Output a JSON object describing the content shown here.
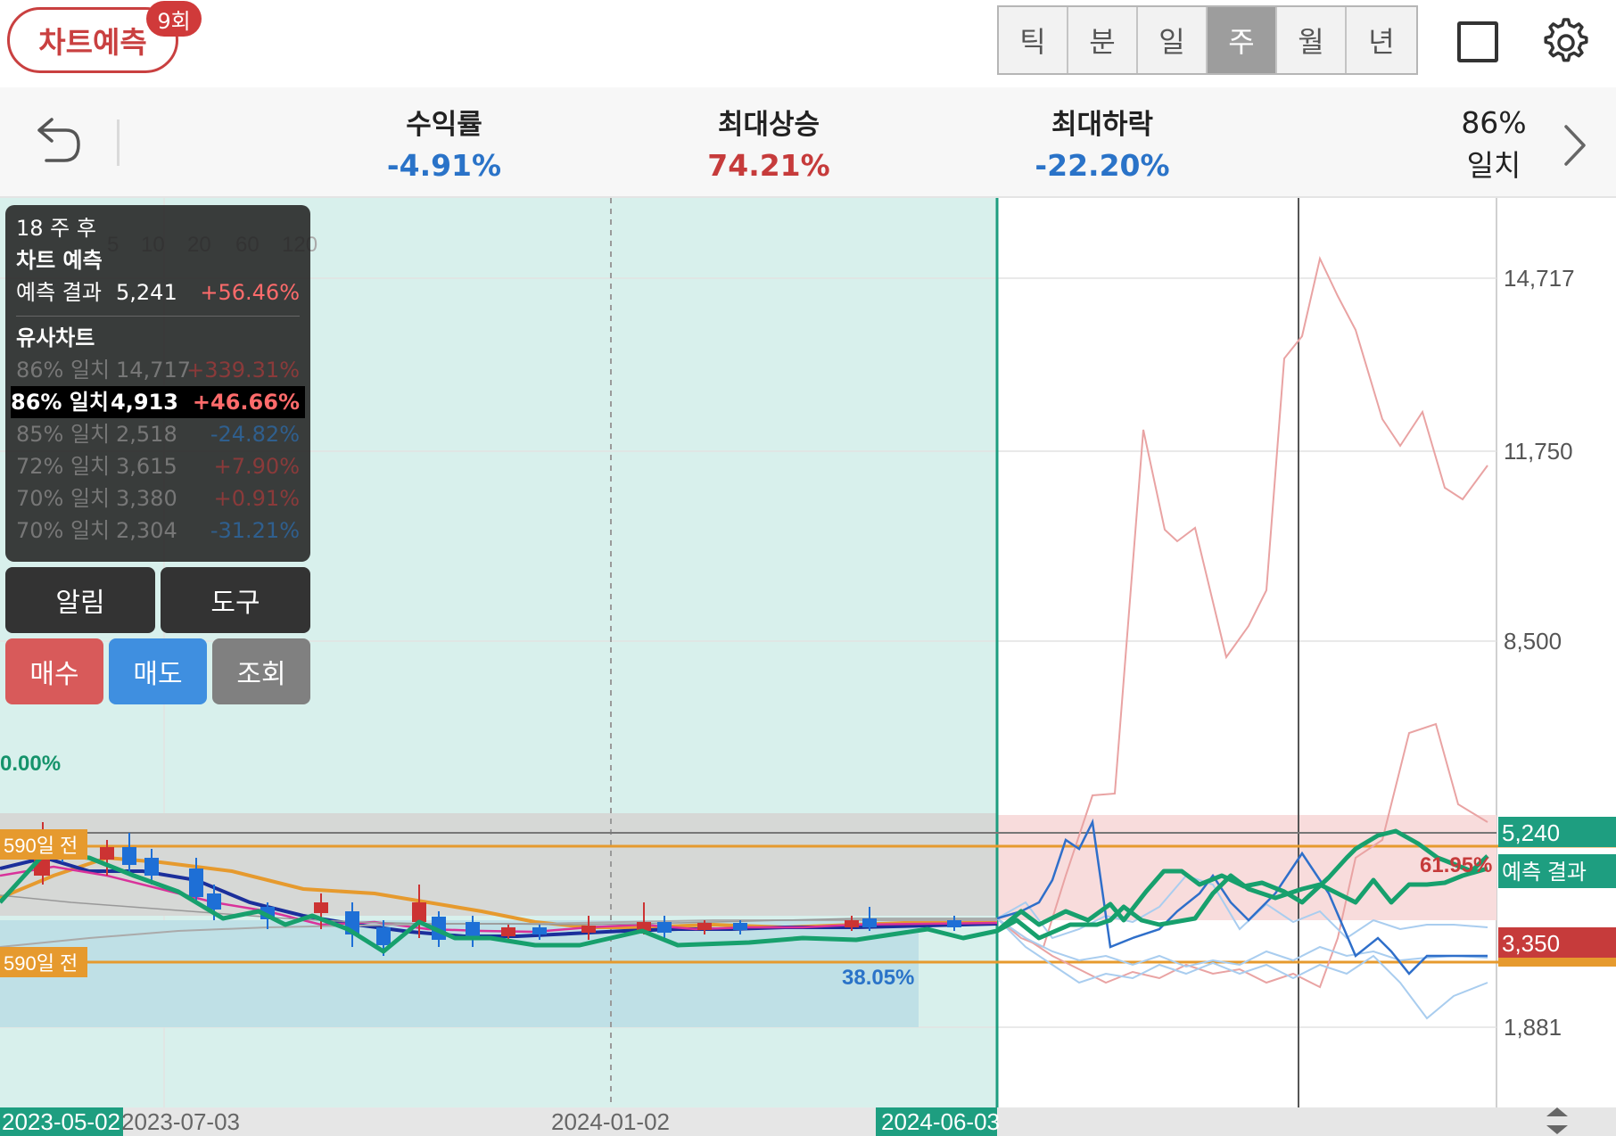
{
  "topbar": {
    "predict_label": "차트예측",
    "predict_badge": "9회",
    "period_tabs": [
      {
        "label": "틱",
        "active": false
      },
      {
        "label": "분",
        "active": false
      },
      {
        "label": "일",
        "active": false
      },
      {
        "label": "주",
        "active": true
      },
      {
        "label": "월",
        "active": false
      },
      {
        "label": "년",
        "active": false
      }
    ],
    "square_icon": "square-outline-icon",
    "settings_icon": "gear-icon"
  },
  "stats": {
    "return_label": "수익률",
    "return_value": "-4.91%",
    "max_rise_label": "최대상승",
    "max_rise_value": "74.21%",
    "max_drop_label": "최대하락",
    "max_drop_value": "-22.20%",
    "match_percent": "86%",
    "match_label": "일치",
    "colors": {
      "positive": "#c63b3b",
      "negative": "#2a73c8"
    }
  },
  "info_panel": {
    "horizon": "18 주 후",
    "predict_title": "차트 예측",
    "predict_result_label": "예측 결과",
    "predict_result_value": "5,241",
    "predict_result_change": "+56.46%",
    "similar_title": "유사차트",
    "similar": [
      {
        "match": "86% 일치",
        "value": "14,717",
        "change": "+339.31%",
        "selected": false,
        "sign": "pos"
      },
      {
        "match": "86% 일치",
        "value": "4,913",
        "change": "+46.66%",
        "selected": true,
        "sign": "pos"
      },
      {
        "match": "85% 일치",
        "value": "2,518",
        "change": "-24.82%",
        "selected": false,
        "sign": "neg"
      },
      {
        "match": "72% 일치",
        "value": "3,615",
        "change": "+7.90%",
        "selected": false,
        "sign": "pos"
      },
      {
        "match": "70% 일치",
        "value": "3,380",
        "change": "+0.91%",
        "selected": false,
        "sign": "pos"
      },
      {
        "match": "70% 일치",
        "value": "2,304",
        "change": "-31.21%",
        "selected": false,
        "sign": "neg"
      }
    ]
  },
  "buttons": {
    "alert": "알림",
    "tools": "도구",
    "buy": "매수",
    "sell": "매도",
    "view": "조회"
  },
  "chart": {
    "ma_legend": [
      "5",
      "10",
      "20",
      "60",
      "120"
    ],
    "y_ticks": [
      "14,717",
      "11,750",
      "8,500",
      "1,881"
    ],
    "price_tags": {
      "forecast": "5,240",
      "forecast_label": "예측 결과",
      "current": "3,350"
    },
    "annotations": {
      "pct_zero": "0.00%",
      "pct_blue": "38.05%",
      "pct_red": "61.95%",
      "days_ago": "590일 전"
    },
    "dates": {
      "start": "2023-05-02",
      "d2": "2023-07-03",
      "d3": "2024-01-02",
      "end": "2024-06-03"
    }
  }
}
